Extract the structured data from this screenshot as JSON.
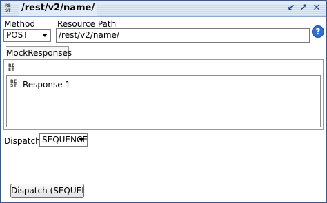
{
  "title": "/rest/v2/name/",
  "method": {
    "label": "Method",
    "value": "POST"
  },
  "resource_path": {
    "label": "Resource Path",
    "value": "/rest/v2/name/"
  },
  "tabs": [
    {
      "label": "MockResponses"
    }
  ],
  "responses": [
    {
      "name": "Response 1"
    }
  ],
  "dispatch": {
    "label": "Dispatch:",
    "value": "SEQUENCE",
    "button_label": "Dispatch (SEQUENC..."
  },
  "icons": {
    "rest": {
      "line1": "RE",
      "line2": "ST"
    },
    "help": "?",
    "title_buttons": [
      "↙",
      "↗",
      "✕"
    ]
  }
}
